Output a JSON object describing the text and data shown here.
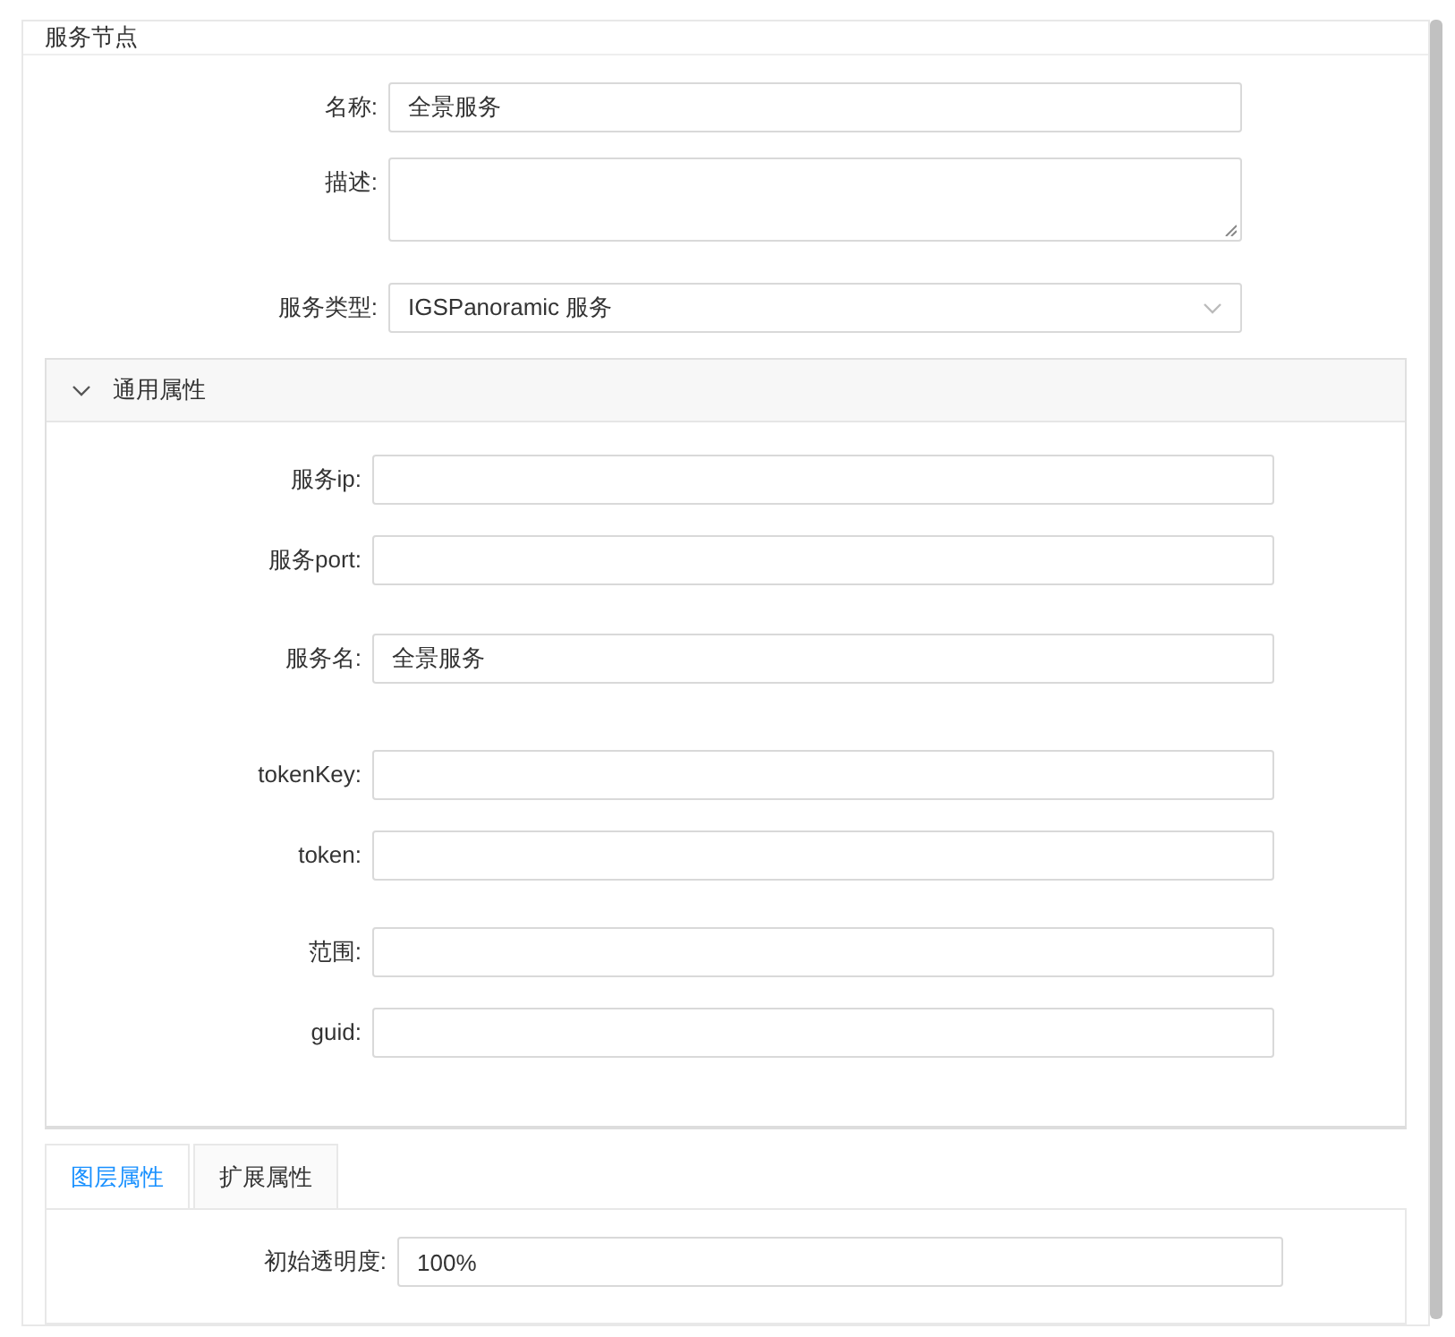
{
  "card": {
    "title": "服务节点"
  },
  "basic_fields": [
    {
      "kind": "input",
      "label": "名称:",
      "value": "全景服务"
    },
    {
      "kind": "textarea",
      "label": "描述:"
    },
    {
      "kind": "select",
      "label": "服务类型:",
      "value": "IGSPanoramic 服务"
    }
  ],
  "collapse": {
    "title": "通用属性",
    "expanded": true,
    "fields": [
      {
        "label": "服务ip:"
      },
      {
        "label": "服务port:"
      },
      {
        "label": "服务名:",
        "value": "全景服务"
      },
      {
        "label": "tokenKey:"
      },
      {
        "label": "token:"
      },
      {
        "label": "范围:"
      },
      {
        "label": "guid:"
      }
    ]
  },
  "tabs": [
    {
      "label": "图层属性",
      "selected": true
    },
    {
      "label": "扩展属性",
      "selected": false
    }
  ],
  "tab_fields": [
    {
      "label": "初始透明度:",
      "value": "100%"
    }
  ]
}
